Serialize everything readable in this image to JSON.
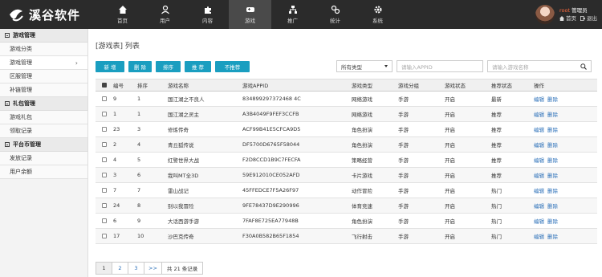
{
  "app": {
    "logo_text": "溪谷软件",
    "nav": [
      {
        "label": "首页",
        "icon": "home-icon"
      },
      {
        "label": "用户",
        "icon": "user-icon"
      },
      {
        "label": "内容",
        "icon": "puzzle-icon"
      },
      {
        "label": "游戏",
        "icon": "game-icon"
      },
      {
        "label": "推广",
        "icon": "network-icon"
      },
      {
        "label": "统计",
        "icon": "stats-icon"
      },
      {
        "label": "系统",
        "icon": "gear-icon"
      }
    ],
    "user": {
      "name": "root",
      "role": "管理员",
      "home_link": "首页",
      "logout_link": "退出"
    }
  },
  "sidebar": {
    "groups": [
      {
        "title": "游戏管理",
        "items": [
          "游戏分类",
          "游戏管理",
          "区服管理",
          "补链管理"
        ]
      },
      {
        "title": "礼包管理",
        "items": [
          "游戏礼包",
          "领取记录"
        ]
      },
      {
        "title": "平台币管理",
        "items": [
          "发放记录",
          "用户余额"
        ]
      }
    ]
  },
  "main": {
    "title": "[游戏表] 列表",
    "buttons": [
      "新 增",
      "删 除",
      "排序",
      "推 荐",
      "不推荐"
    ],
    "filter_type": "所有类型",
    "search_appid_placeholder": "请输入APPID",
    "search_name_placeholder": "请输入游戏名称",
    "table": {
      "headers": [
        "编号",
        "排序",
        "游戏名称",
        "游戏APPID",
        "游戏类型",
        "游戏分组",
        "游戏状态",
        "推荐状态",
        "操作"
      ],
      "rows": [
        [
          "9",
          "1",
          "国江湖之不良人",
          "834899297372468 4C",
          "网络游戏",
          "手游",
          "开启",
          "最新"
        ],
        [
          "1",
          "1",
          "国江湖之灵主",
          "A3B4049F9FEF3CCFB",
          "网络游戏",
          "手游",
          "开启",
          "推荐"
        ],
        [
          "23",
          "3",
          "修炼传奇",
          "ACF99B41E5CFCA9D5",
          "角色扮演",
          "手游",
          "开启",
          "推荐"
        ],
        [
          "2",
          "4",
          "青丘狐传说",
          "DF5700D6765F58044",
          "角色扮演",
          "手游",
          "开启",
          "推荐"
        ],
        [
          "4",
          "5",
          "红警世界大战",
          "F2D8CCD1B9C7FECFA",
          "策略经营",
          "手游",
          "开启",
          "推荐"
        ],
        [
          "3",
          "6",
          "我叫MT全3D",
          "59E912010CE052AFD",
          "卡片游戏",
          "手游",
          "开启",
          "推荐"
        ],
        [
          "7",
          "7",
          "雷山战记",
          "45FFEDCE7F5A26F97",
          "动作冒险",
          "手游",
          "开启",
          "热门"
        ],
        [
          "24",
          "8",
          "别以我冒险",
          "9FE78437D9E290996",
          "体育竞速",
          "手游",
          "开启",
          "热门"
        ],
        [
          "6",
          "9",
          "大话西游手游",
          "7FAF8E725EA77948B",
          "角色扮演",
          "手游",
          "开启",
          "热门"
        ],
        [
          "17",
          "10",
          "沙巴克传奇",
          "F30A0B582B65F1854",
          "飞行射击",
          "手游",
          "开启",
          "热门"
        ]
      ],
      "op_edit": "编辑",
      "op_delete": "删除"
    },
    "pagination": {
      "pages": [
        "1",
        "2",
        "3",
        ">>"
      ],
      "current": "1",
      "total_text": "共 21 条记录"
    }
  }
}
